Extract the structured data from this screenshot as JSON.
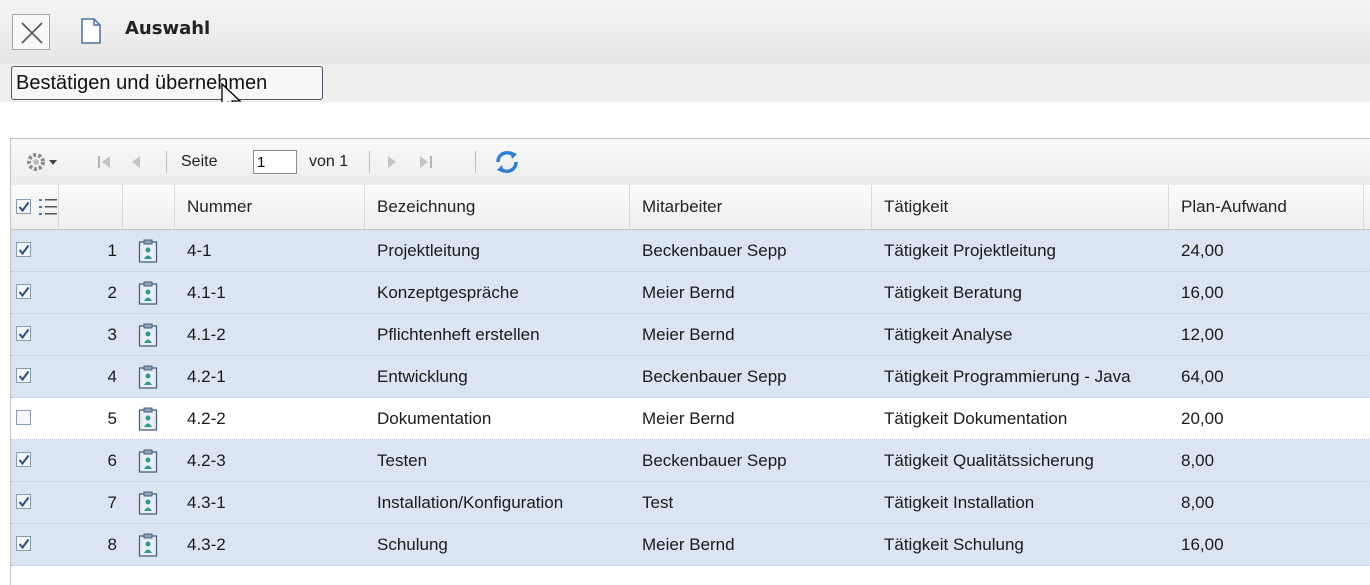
{
  "window": {
    "title": "Auswahl",
    "icons": {
      "close": "close-icon",
      "document": "document-icon"
    }
  },
  "toolbar": {
    "confirm_label": "Bestätigen und übernehmen"
  },
  "pager": {
    "page_label": "Seite",
    "page_value": "1",
    "of_label": "von 1",
    "icons": [
      "gear-icon",
      "first-page-icon",
      "prev-page-icon",
      "next-page-icon",
      "last-page-icon",
      "refresh-icon"
    ]
  },
  "table": {
    "columns": [
      "Nummer",
      "Bezeichnung",
      "Mitarbeiter",
      "Tätigkeit",
      "Plan-Aufwand"
    ],
    "header_select_all": true,
    "rows": [
      {
        "selected": true,
        "index": "1",
        "nummer": "4-1",
        "bezeichnung": "Projektleitung",
        "mitarbeiter": "Beckenbauer Sepp",
        "taetigkeit": "Tätigkeit Projektleitung",
        "aufwand": "24,00"
      },
      {
        "selected": true,
        "index": "2",
        "nummer": "4.1-1",
        "bezeichnung": "Konzeptgespräche",
        "mitarbeiter": "Meier Bernd",
        "taetigkeit": "Tätigkeit Beratung",
        "aufwand": "16,00"
      },
      {
        "selected": true,
        "index": "3",
        "nummer": "4.1-2",
        "bezeichnung": "Pflichtenheft erstellen",
        "mitarbeiter": "Meier Bernd",
        "taetigkeit": "Tätigkeit Analyse",
        "aufwand": "12,00"
      },
      {
        "selected": true,
        "index": "4",
        "nummer": "4.2-1",
        "bezeichnung": "Entwicklung",
        "mitarbeiter": "Beckenbauer Sepp",
        "taetigkeit": "Tätigkeit Programmierung - Java",
        "aufwand": "64,00"
      },
      {
        "selected": false,
        "index": "5",
        "nummer": "4.2-2",
        "bezeichnung": "Dokumentation",
        "mitarbeiter": "Meier Bernd",
        "taetigkeit": "Tätigkeit Dokumentation",
        "aufwand": "20,00"
      },
      {
        "selected": true,
        "index": "6",
        "nummer": "4.2-3",
        "bezeichnung": "Testen",
        "mitarbeiter": "Beckenbauer Sepp",
        "taetigkeit": "Tätigkeit Qualitätssicherung",
        "aufwand": "8,00"
      },
      {
        "selected": true,
        "index": "7",
        "nummer": "4.3-1",
        "bezeichnung": "Installation/Konfiguration",
        "mitarbeiter": "Test",
        "taetigkeit": "Tätigkeit Installation",
        "aufwand": "8,00"
      },
      {
        "selected": true,
        "index": "8",
        "nummer": "4.3-2",
        "bezeichnung": "Schulung",
        "mitarbeiter": "Meier Bernd",
        "taetigkeit": "Tätigkeit Schulung",
        "aufwand": "16,00"
      }
    ]
  },
  "colors": {
    "selected_row": "#dbe4f2",
    "refresh": "#2b7fd6",
    "checkmark": "#2c4f8a"
  }
}
